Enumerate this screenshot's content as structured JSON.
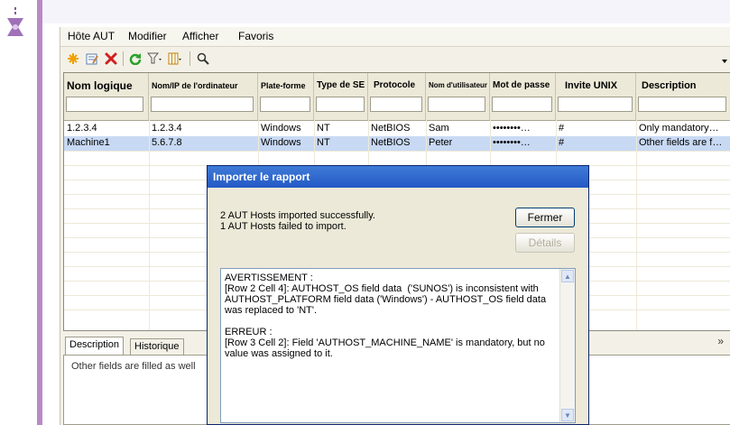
{
  "menu": [
    "Hôte AUT",
    "Modifier",
    "Afficher",
    "Favoris"
  ],
  "toolbar_icons": [
    "new-star-icon",
    "edit-icon",
    "delete-x-icon",
    "refresh-icon",
    "filter-icon",
    "columns-icon",
    "search-icon"
  ],
  "grid": {
    "columns": [
      "Nom logique",
      "Nom/IP de l'ordinateur",
      "Plate-forme",
      "Type de SE",
      "Protocole",
      "Nom d'utilisateur",
      "Mot de passe",
      "Invite UNIX",
      "Description"
    ],
    "rows": [
      [
        "1.2.3.4",
        "1.2.3.4",
        "Windows",
        "NT",
        "NetBIOS",
        "Sam",
        "••••••••…",
        "#",
        "Only mandatory…"
      ],
      [
        "Machine1",
        "5.6.7.8",
        "Windows",
        "NT",
        "NetBIOS",
        "Peter",
        "••••••••…",
        "#",
        "Other fields are f…"
      ]
    ],
    "selected_row": 1
  },
  "bottom": {
    "tabs": [
      "Description",
      "Historique"
    ],
    "description_text": "Other fields are filled as well",
    "collapse_glyph": "»"
  },
  "dialog": {
    "title": "Importer le rapport",
    "line1": "2 AUT Hosts imported successfully.",
    "line2": "1 AUT Hosts failed to import.",
    "close_label": "Fermer",
    "details_label": "Détails",
    "log": "AVERTISSEMENT :\n[Row 2 Cell 4]: AUTHOST_OS field data  ('SUNOS') is inconsistent with AUTHOST_PLATFORM field data ('Windows') - AUTHOST_OS field data was replaced to 'NT'.\n\nERREUR :\n[Row 3 Cell 2]: Field 'AUTHOST_MACHINE_NAME' is mandatory, but no value was assigned to it."
  },
  "colors": {
    "accent_bar": "#b98ac6",
    "selection": "#c8d9f4",
    "title_bar": "#2f67cf"
  }
}
